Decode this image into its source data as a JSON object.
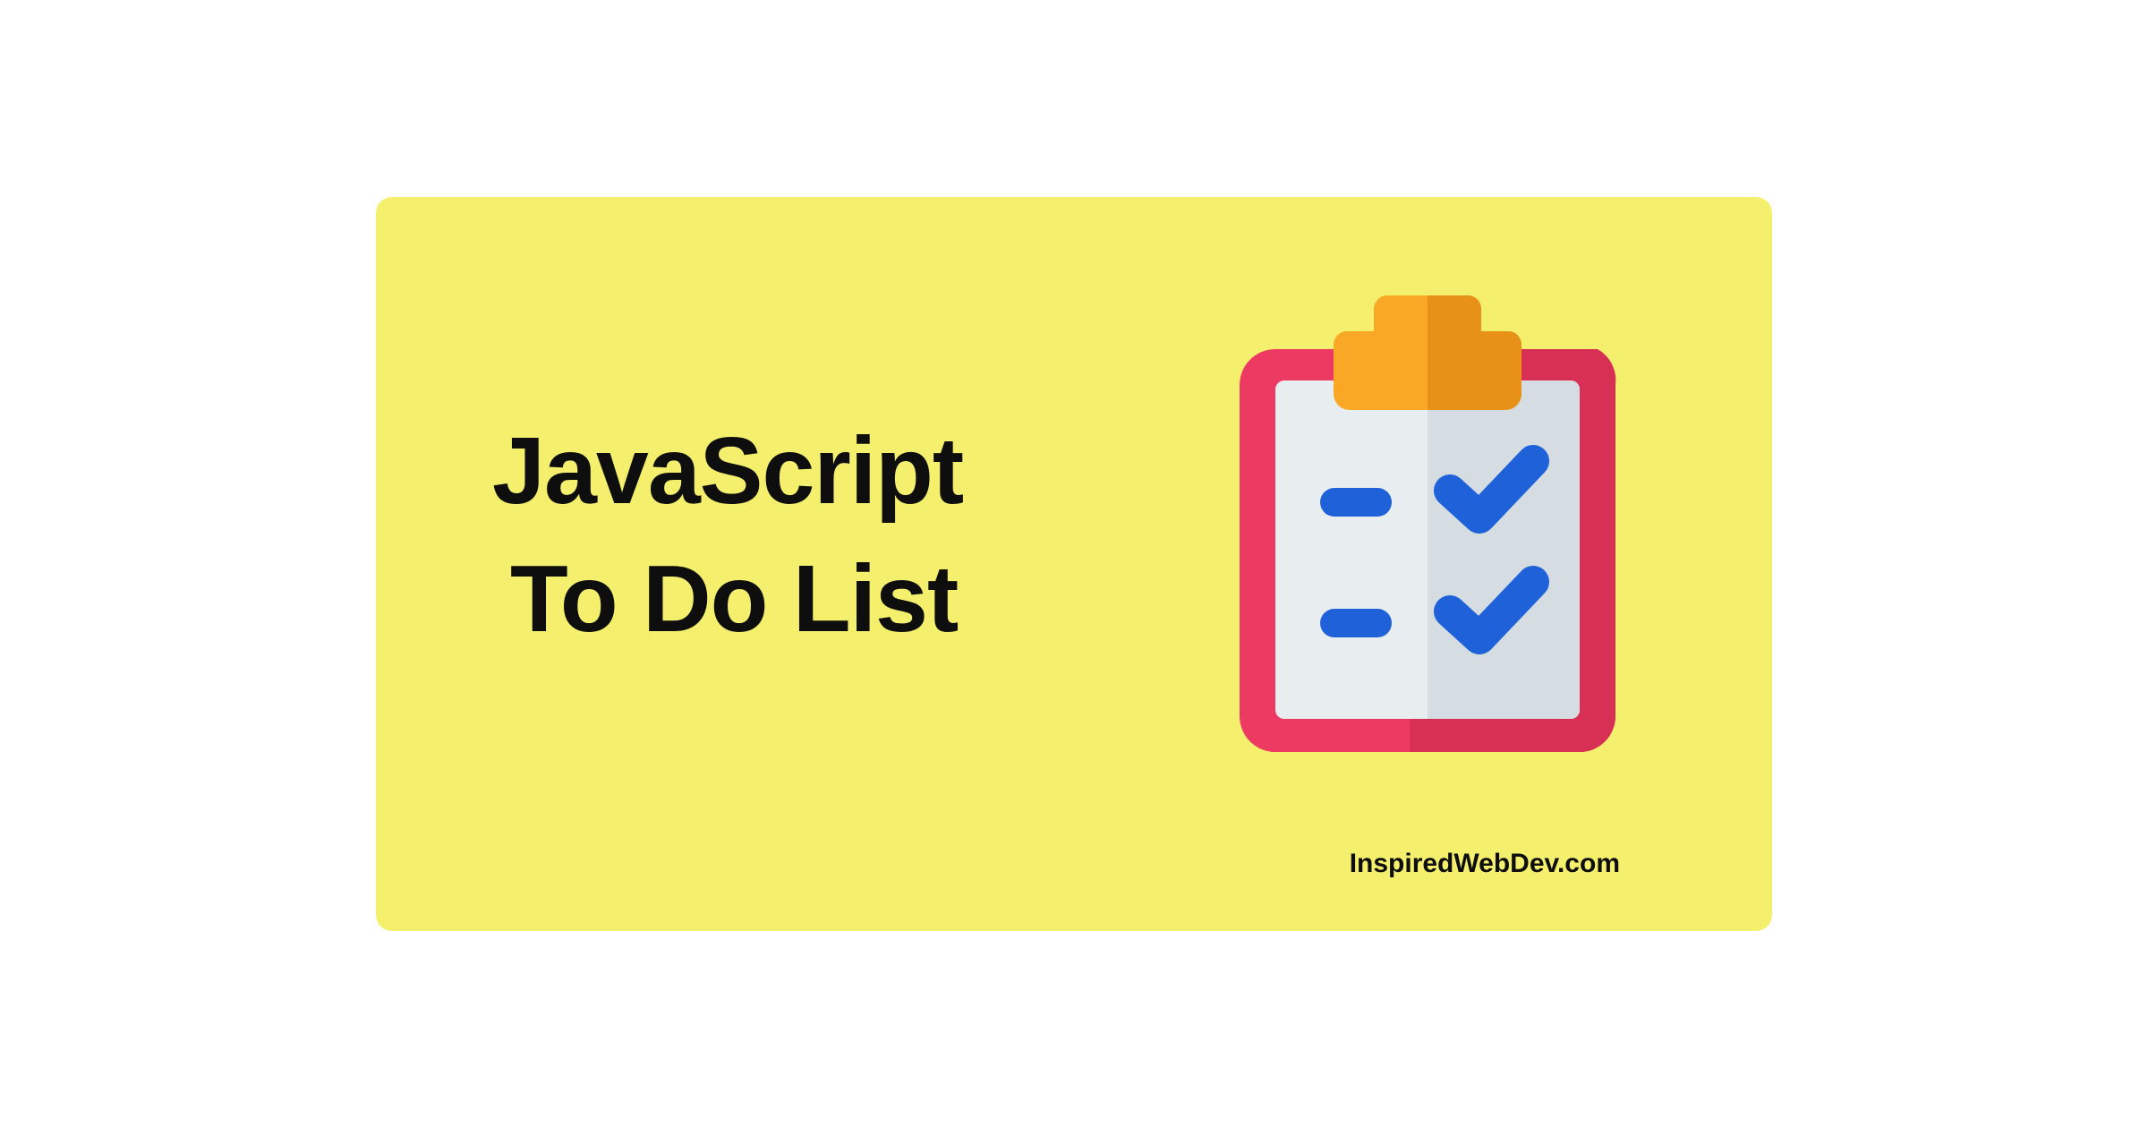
{
  "title": {
    "line1": "JavaScript",
    "line2": "To Do List"
  },
  "attribution": "InspiredWebDev.com",
  "colors": {
    "background": "#f4f06d",
    "text": "#0e0e0e",
    "clipboard_board": "#ed3a63",
    "clipboard_board_shadow": "#d82f55",
    "clipboard_paper": "#e8edf0",
    "clipboard_paper_shadow": "#d6dde2",
    "clip": "#f9a825",
    "clip_shadow": "#e89118",
    "check": "#1f61d8",
    "check_shadow": "#1a4fb8"
  }
}
